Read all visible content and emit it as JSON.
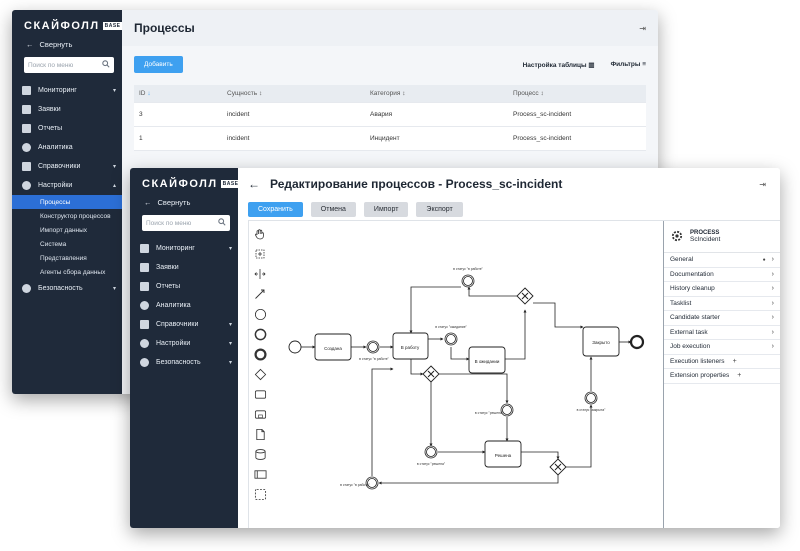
{
  "brand": {
    "logo_text": "СКАЙФОЛЛ",
    "edition": "BASE"
  },
  "window1": {
    "collapse_label": "Свернуть",
    "search_placeholder": "Поиск по меню",
    "nav": [
      {
        "label": "Мониторинг",
        "icon": "monitoring-icon",
        "chevron": "▾"
      },
      {
        "label": "Заявки",
        "icon": "requests-icon",
        "chevron": ""
      },
      {
        "label": "Отчеты",
        "icon": "reports-icon",
        "chevron": ""
      },
      {
        "label": "Аналитика",
        "icon": "analytics-icon",
        "chevron": ""
      },
      {
        "label": "Справочники",
        "icon": "directories-icon",
        "chevron": "▾"
      },
      {
        "label": "Настройки",
        "icon": "gear-icon",
        "chevron": "▴"
      }
    ],
    "sub_nav": [
      "Процессы",
      "Конструктор процессов",
      "Импорт данных",
      "Система",
      "Представления",
      "Агенты сбора данных"
    ],
    "nav_bottom": {
      "label": "Безопасность",
      "icon": "shield-icon",
      "chevron": "▾"
    },
    "page_title": "Процессы",
    "add_button": "Добавить",
    "table_settings": "Настройка таблицы",
    "filters": "Фильтры",
    "table": {
      "headers": [
        "ID",
        "Сущность",
        "Категория",
        "Процесс"
      ],
      "rows": [
        [
          "3",
          "incident",
          "Авария",
          "Process_sc-incident"
        ],
        [
          "1",
          "incident",
          "Инцидент",
          "Process_sc-incident"
        ]
      ]
    }
  },
  "window2": {
    "collapse_label": "Свернуть",
    "search_placeholder": "Поиск по меню",
    "nav": [
      {
        "label": "Мониторинг",
        "icon": "monitoring-icon",
        "chevron": "▾"
      },
      {
        "label": "Заявки",
        "icon": "requests-icon",
        "chevron": ""
      },
      {
        "label": "Отчеты",
        "icon": "reports-icon",
        "chevron": ""
      },
      {
        "label": "Аналитика",
        "icon": "analytics-icon",
        "chevron": ""
      },
      {
        "label": "Справочники",
        "icon": "directories-icon",
        "chevron": "▾"
      },
      {
        "label": "Настройки",
        "icon": "gear-icon",
        "chevron": "▾"
      },
      {
        "label": "Безопасность",
        "icon": "shield-icon",
        "chevron": "▾"
      }
    ],
    "page_title": "Редактирование процессов - Process_sc-incident",
    "buttons": {
      "save": "Сохранить",
      "cancel": "Отмена",
      "import": "Импорт",
      "export": "Экспорт"
    },
    "diagram": {
      "tasks": [
        "Создана",
        "В работу",
        "В ожидании",
        "Закрыто",
        "Решена"
      ],
      "events": [
        "в статус \"в работе\"",
        "в статус \"ожидание\"",
        "в статус \"в работе\"",
        "в статус \"решена\"",
        "в статус \"закрыта\"",
        "в статус \"решена\"",
        "в статус \"в работе\""
      ]
    },
    "props_panel": {
      "kind": "PROCESS",
      "name": "ScIncident",
      "sections": [
        {
          "label": "General",
          "marker": "●",
          "action": "›"
        },
        {
          "label": "Documentation",
          "marker": "",
          "action": "›"
        },
        {
          "label": "History cleanup",
          "marker": "",
          "action": "›"
        },
        {
          "label": "Tasklist",
          "marker": "",
          "action": "›"
        },
        {
          "label": "Candidate starter",
          "marker": "",
          "action": "›"
        },
        {
          "label": "External task",
          "marker": "",
          "action": "›"
        },
        {
          "label": "Job execution",
          "marker": "",
          "action": "›"
        },
        {
          "label": "Execution listeners",
          "marker": "",
          "action": "+"
        },
        {
          "label": "Extension properties",
          "marker": "",
          "action": "+"
        }
      ]
    }
  }
}
